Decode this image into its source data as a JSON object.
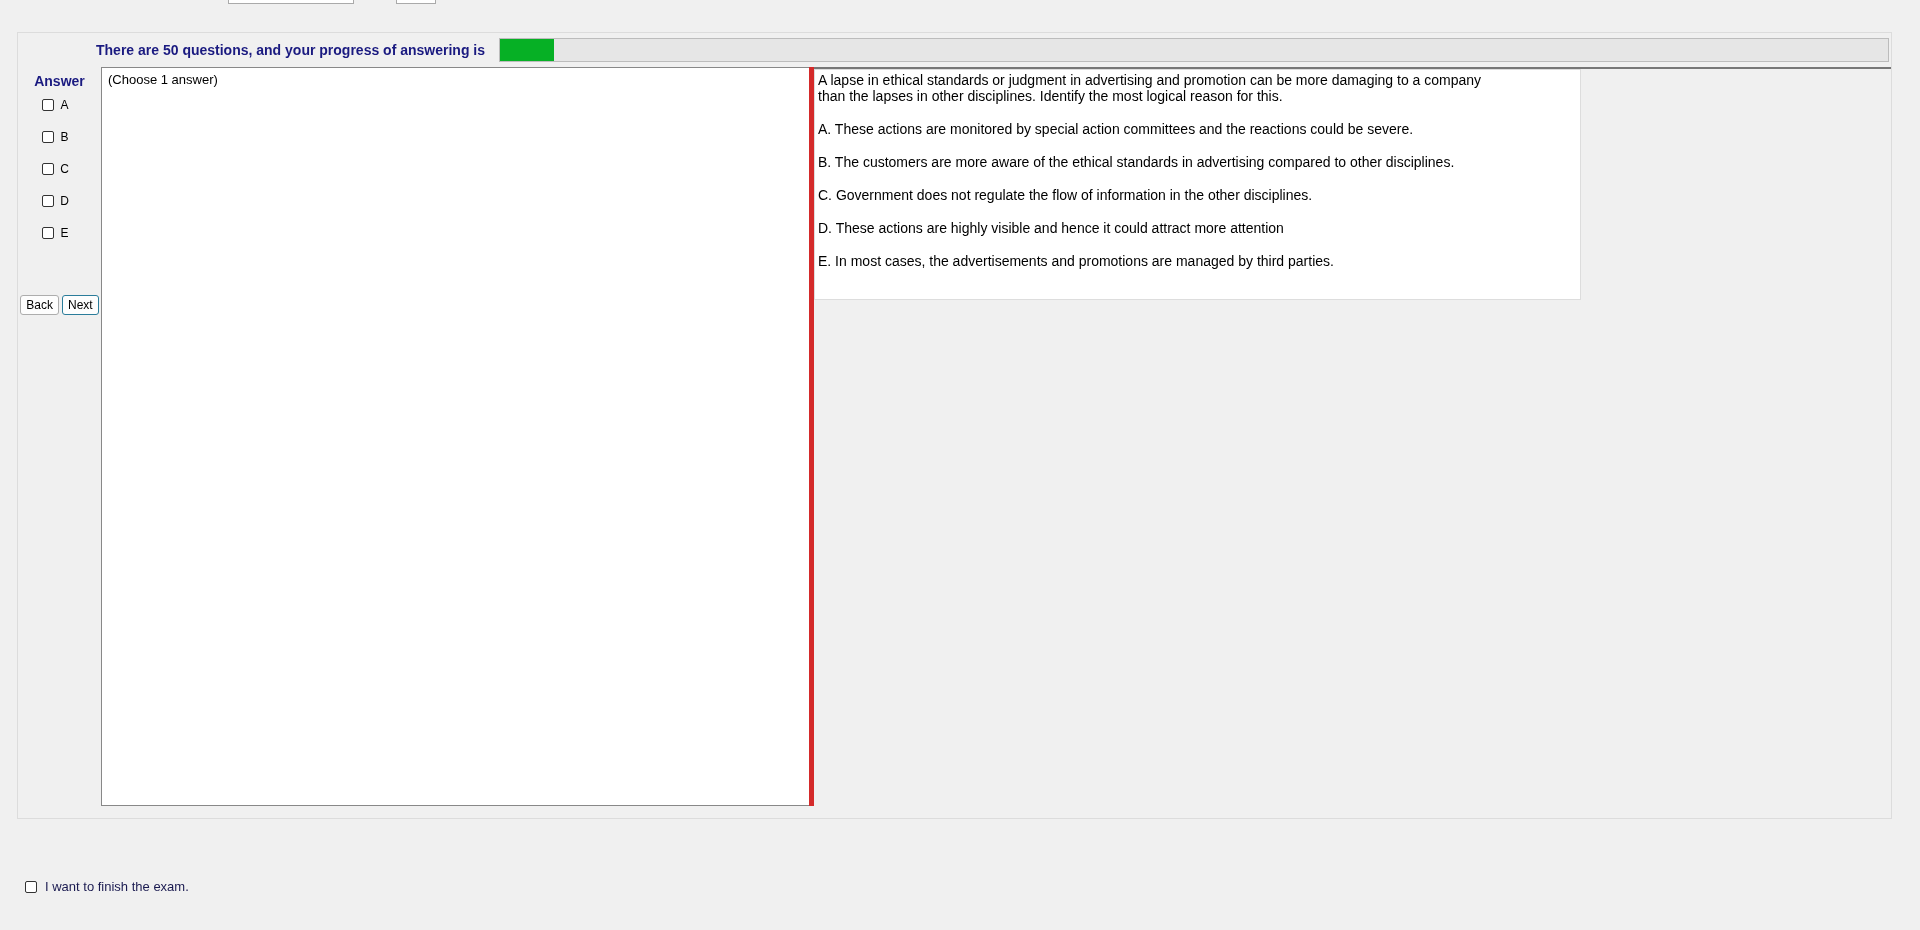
{
  "progress": {
    "label": "There are 50 questions, and your progress of answering is",
    "level": 0.039
  },
  "answer": {
    "title": "Answer",
    "options": [
      {
        "label": "A",
        "checked": false
      },
      {
        "label": "B",
        "checked": false
      },
      {
        "label": "C",
        "checked": false
      },
      {
        "label": "D",
        "checked": false
      },
      {
        "label": "E",
        "checked": false
      }
    ]
  },
  "buttons": [
    "Back",
    "Next"
  ],
  "hint": "(Choose 1 answer)",
  "question": {
    "lines": [
      "A lapse in ethical standards or judgment in advertising and promotion can be more damaging to a company",
      "than the lapses in other disciplines. Identify the most logical reason for this."
    ],
    "choices": [
      "A.  These actions are monitored by special action committees and the reactions could be severe.",
      "B.  The customers are more aware of the ethical standards in advertising compared to other disciplines.",
      "C.  Government does not regulate the flow of information in the other disciplines.",
      "D.  These actions are highly visible and hence it could attract more attention",
      "E.  In most cases, the advertisements and promotions are managed by third parties."
    ]
  },
  "finish": {
    "label": "I want to finish the exam.",
    "checked": false
  }
}
